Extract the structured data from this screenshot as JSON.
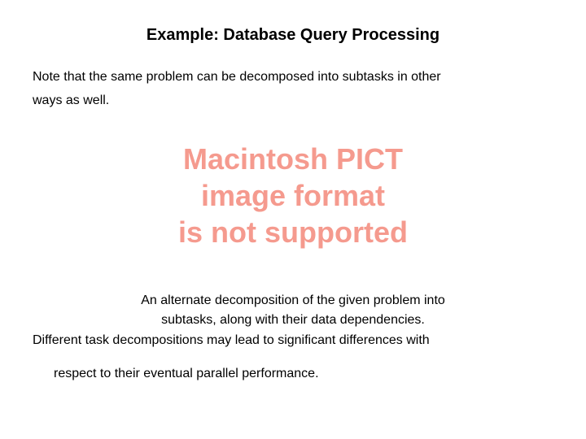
{
  "colors": {
    "placeholder": "#f59a8e"
  },
  "title": "Example: Database Query Processing",
  "intro_line1": "Note that the same problem can be decomposed into subtasks in other",
  "intro_line2": "ways as well.",
  "placeholder": {
    "line1": "Macintosh PICT",
    "line2": "image format",
    "line3": "is not supported"
  },
  "caption": {
    "line1": "An alternate decomposition of the given problem into",
    "line2": "subtasks, along with their data dependencies.",
    "line3": "Different task decompositions may lead to significant differences with",
    "line4": "respect to their eventual parallel performance."
  }
}
